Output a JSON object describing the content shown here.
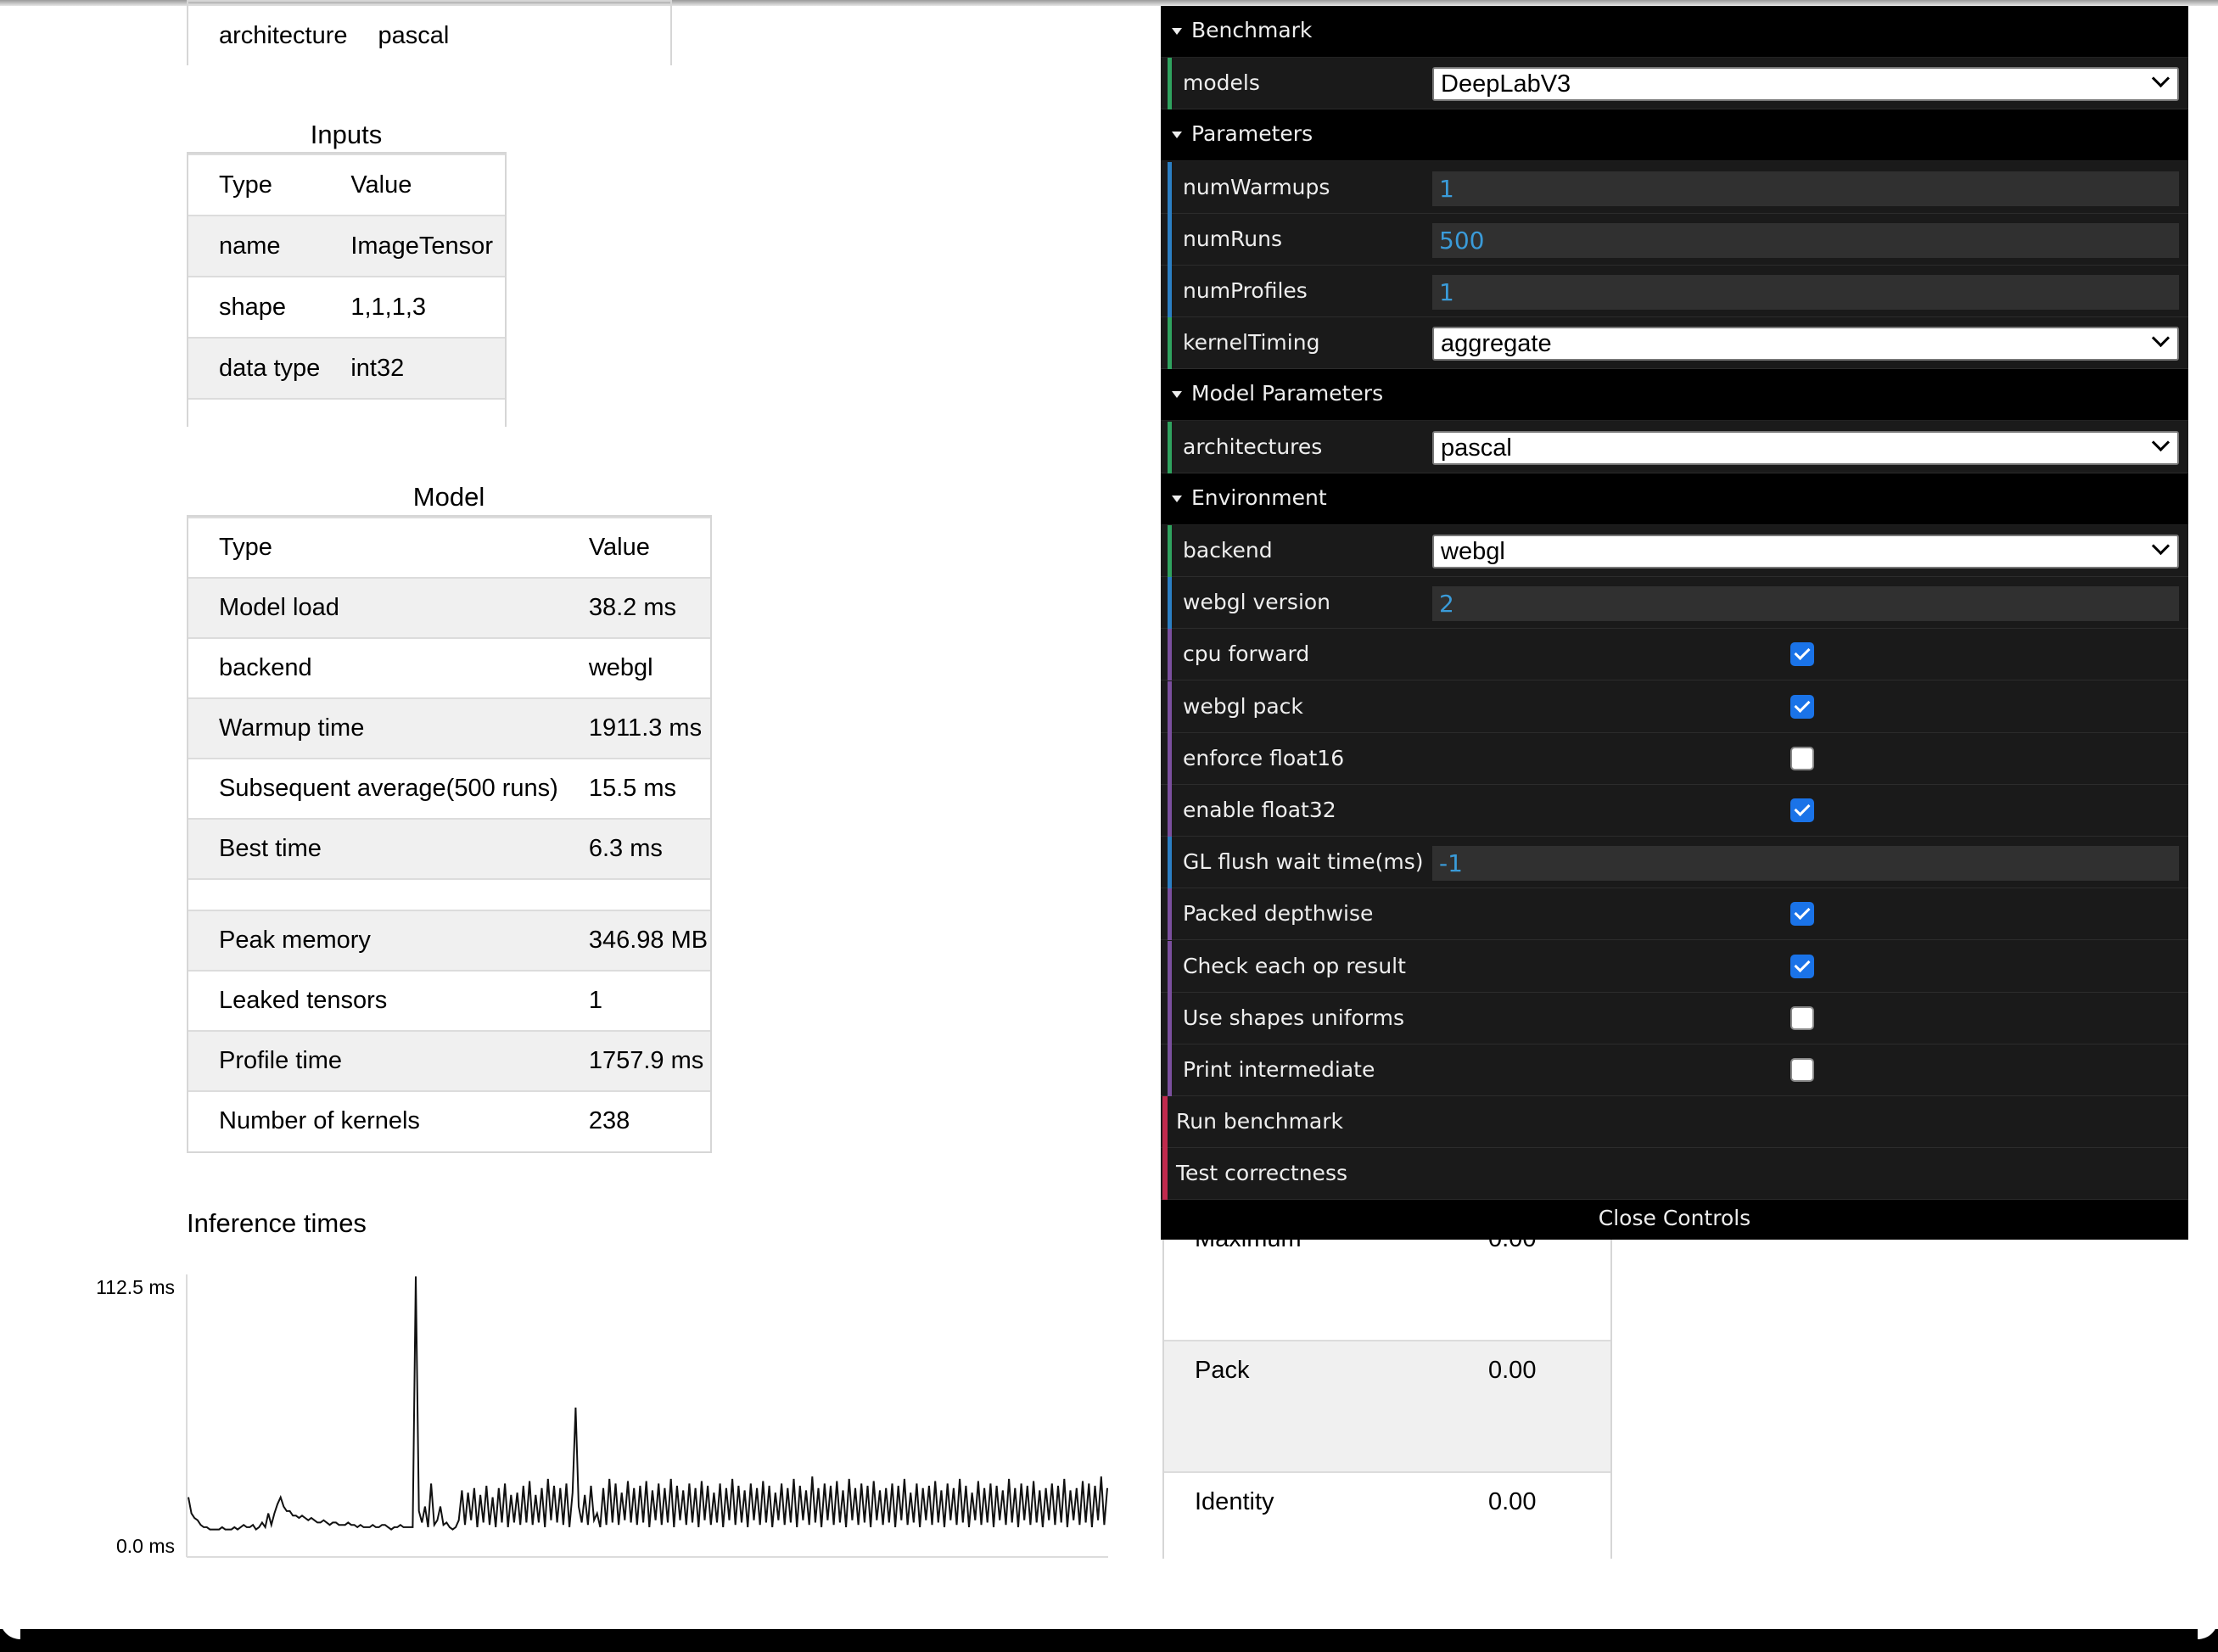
{
  "arch_table": {
    "rows": [
      [
        "architecture",
        "pascal"
      ]
    ]
  },
  "inputs": {
    "title": "Inputs",
    "header": [
      "Type",
      "Value"
    ],
    "rows": [
      [
        "name",
        "ImageTensor"
      ],
      [
        "shape",
        "1,1,1,3"
      ],
      [
        "data type",
        "int32"
      ]
    ]
  },
  "model": {
    "title": "Model",
    "header": [
      "Type",
      "Value"
    ],
    "rows": [
      [
        "Model load",
        "38.2 ms"
      ],
      [
        "backend",
        "webgl"
      ],
      [
        "Warmup time",
        "1911.3 ms"
      ],
      [
        "Subsequent average(500 runs)",
        "15.5 ms"
      ],
      [
        "Best time",
        "6.3 ms"
      ],
      [
        "",
        ""
      ],
      [
        "Peak memory",
        "346.98 MB"
      ],
      [
        "Leaked tensors",
        "1"
      ],
      [
        "Profile time",
        "1757.9 ms"
      ],
      [
        "Number of kernels",
        "238"
      ]
    ]
  },
  "kernels": {
    "rows": [
      [
        "Maximum",
        "0.00"
      ],
      [
        "Pack",
        "0.00"
      ],
      [
        "Identity",
        "0.00"
      ]
    ]
  },
  "chart_data": {
    "type": "line",
    "title": "Inference times",
    "ylim": [
      0,
      112.5
    ],
    "ytick_labels": [
      "112.5 ms",
      "0.0 ms"
    ],
    "series": [
      {
        "values": [
          16,
          9,
          7,
          6,
          4,
          3,
          3,
          2,
          2,
          2,
          2,
          3,
          2,
          2,
          2,
          3,
          2,
          3,
          4,
          3,
          3,
          4,
          2,
          3,
          5,
          3,
          9,
          4,
          9,
          13,
          16,
          12,
          10,
          10,
          8,
          8,
          7,
          8,
          7,
          6,
          7,
          6,
          5,
          5,
          6,
          5,
          4,
          5,
          5,
          4,
          4,
          4,
          5,
          4,
          4,
          3,
          4,
          3,
          3,
          3,
          4,
          3,
          3,
          4,
          4,
          3,
          2,
          3,
          3,
          4,
          3,
          3,
          3,
          3,
          112,
          10,
          5,
          12,
          3,
          22,
          4,
          6,
          12,
          4,
          5,
          3,
          2,
          3,
          6,
          19,
          4,
          18,
          6,
          20,
          3,
          17,
          5,
          21,
          4,
          16,
          3,
          20,
          5,
          22,
          3,
          17,
          5,
          18,
          4,
          21,
          5,
          23,
          4,
          17,
          5,
          20,
          3,
          24,
          6,
          21,
          5,
          20,
          4,
          22,
          3,
          18,
          55,
          12,
          5,
          17,
          4,
          21,
          6,
          9,
          3,
          20,
          4,
          24,
          5,
          22,
          4,
          18,
          6,
          23,
          5,
          20,
          4,
          21,
          5,
          23,
          3,
          19,
          6,
          22,
          4,
          20,
          5,
          24,
          3,
          21,
          6,
          19,
          4,
          22,
          5,
          20,
          3,
          23,
          6,
          21,
          4,
          18,
          5,
          22,
          3,
          20,
          6,
          24,
          4,
          21,
          5,
          19,
          3,
          22,
          6,
          20,
          4,
          23,
          5,
          21,
          3,
          18,
          6,
          22,
          4,
          20,
          5,
          24,
          3,
          21,
          6,
          19,
          4,
          25,
          5,
          20,
          3,
          22,
          6,
          21,
          4,
          23,
          5,
          19,
          3,
          24,
          6,
          20,
          4,
          22,
          5,
          21,
          3,
          23,
          6,
          19,
          4,
          20,
          5,
          22,
          3,
          21,
          6,
          24,
          4,
          18,
          5,
          22,
          3,
          20,
          6,
          21,
          4,
          23,
          5,
          19,
          3,
          22,
          6,
          20,
          4,
          24,
          5,
          21,
          3,
          18,
          6,
          23,
          4,
          20,
          5,
          22,
          3,
          21,
          6,
          19,
          4,
          24,
          5,
          20,
          3,
          22,
          6,
          21,
          4,
          23,
          5,
          19,
          3,
          20,
          6,
          22,
          4,
          21,
          5,
          24,
          3,
          19,
          6,
          20,
          4,
          23,
          5,
          22,
          3,
          21,
          6,
          25,
          4,
          20
        ]
      }
    ]
  },
  "controls": {
    "close_label": "Close Controls",
    "rows": [
      {
        "kind": "folder",
        "label": "Benchmark"
      },
      {
        "kind": "select",
        "label": "models",
        "value": "DeepLabV3",
        "stripe": "green"
      },
      {
        "kind": "folder",
        "label": "Parameters"
      },
      {
        "kind": "number",
        "label": "numWarmups",
        "value": "1",
        "stripe": "blue"
      },
      {
        "kind": "number",
        "label": "numRuns",
        "value": "500",
        "stripe": "blue"
      },
      {
        "kind": "number",
        "label": "numProfiles",
        "value": "1",
        "stripe": "blue"
      },
      {
        "kind": "select",
        "label": "kernelTiming",
        "value": "aggregate",
        "stripe": "green"
      },
      {
        "kind": "folder",
        "label": "Model Parameters"
      },
      {
        "kind": "select",
        "label": "architectures",
        "value": "pascal",
        "stripe": "green"
      },
      {
        "kind": "folder",
        "label": "Environment"
      },
      {
        "kind": "select",
        "label": "backend",
        "value": "webgl",
        "stripe": "green"
      },
      {
        "kind": "number",
        "label": "webgl version",
        "value": "2",
        "stripe": "blue"
      },
      {
        "kind": "checkbox",
        "label": "cpu forward",
        "checked": true,
        "stripe": "purple"
      },
      {
        "kind": "checkbox",
        "label": "webgl pack",
        "checked": true,
        "stripe": "purple"
      },
      {
        "kind": "checkbox",
        "label": "enforce float16",
        "checked": false,
        "stripe": "purple"
      },
      {
        "kind": "checkbox",
        "label": "enable float32",
        "checked": true,
        "stripe": "purple"
      },
      {
        "kind": "number",
        "label": "GL flush wait time(ms)",
        "value": "-1",
        "stripe": "blue"
      },
      {
        "kind": "checkbox",
        "label": "Packed depthwise",
        "checked": true,
        "stripe": "purple"
      },
      {
        "kind": "checkbox",
        "label": "Check each op result",
        "checked": true,
        "stripe": "purple"
      },
      {
        "kind": "checkbox",
        "label": "Use shapes uniforms",
        "checked": false,
        "stripe": "purple"
      },
      {
        "kind": "checkbox",
        "label": "Print intermediate",
        "checked": false,
        "stripe": "purple"
      },
      {
        "kind": "button",
        "label": "Run benchmark",
        "stripe": "red"
      },
      {
        "kind": "button",
        "label": "Test correctness",
        "stripe": "red"
      }
    ]
  }
}
